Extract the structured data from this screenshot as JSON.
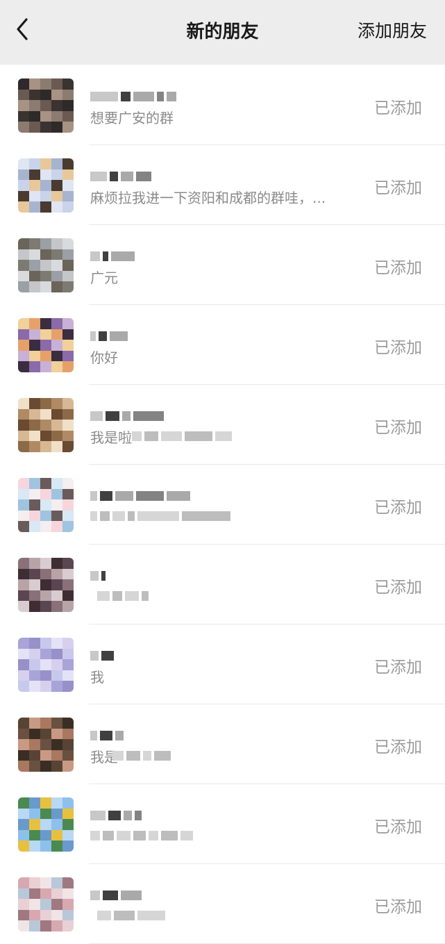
{
  "nav": {
    "back_icon": "chevron-left-icon",
    "title": "新的朋友",
    "action_label": "添加朋友"
  },
  "requests": [
    {
      "message": "想要广安的群",
      "status": "已添加",
      "avatar_colors": [
        "#2d2a29",
        "#6b5a52",
        "#a89284",
        "#3a3330",
        "#8c7b70"
      ]
    },
    {
      "message": "麻烦拉我进一下资阳和成都的群哇，...",
      "status": "已添加",
      "avatar_colors": [
        "#c9d4ea",
        "#4a3a30",
        "#e8c89a",
        "#dfe5f2",
        "#a7b4cf"
      ]
    },
    {
      "message": "广元",
      "status": "已添加",
      "avatar_colors": [
        "#9b9fa6",
        "#6a645a",
        "#c4c6ca",
        "#7d7a72",
        "#d9dadc"
      ]
    },
    {
      "message": "你好",
      "status": "已添加",
      "avatar_colors": [
        "#8a6aa8",
        "#e6a16a",
        "#c9b0d6",
        "#3a2d3f",
        "#f1d09a"
      ]
    },
    {
      "message": "我是啦",
      "status": "已添加",
      "avatar_colors": [
        "#d6b894",
        "#8c6a48",
        "#f0e0c8",
        "#b08a64",
        "#6a4a30"
      ]
    },
    {
      "message": "",
      "status": "已添加",
      "avatar_colors": [
        "#f6d6dc",
        "#d8e8f4",
        "#9ec4e0",
        "#f4eef0",
        "#6a5a5a"
      ]
    },
    {
      "message": "",
      "status": "已添加",
      "avatar_colors": [
        "#b8a4a8",
        "#5a4650",
        "#d8ccd0",
        "#8a7078",
        "#3e2e34"
      ]
    },
    {
      "message": "我",
      "status": "已添加",
      "avatar_colors": [
        "#c8c8ec",
        "#a8a4d8",
        "#e4e2f6",
        "#9890c8",
        "#d6d0ee"
      ]
    },
    {
      "message": "我是",
      "status": "已添加",
      "avatar_colors": [
        "#6a5040",
        "#c89a84",
        "#3a2e24",
        "#a87860",
        "#584434"
      ]
    },
    {
      "message": "",
      "status": "已添加",
      "avatar_colors": [
        "#8ec0ec",
        "#e8c040",
        "#4a8a50",
        "#b8d8f4",
        "#6a9acc"
      ]
    },
    {
      "message": "",
      "status": "已添加",
      "avatar_colors": [
        "#d8a8b0",
        "#b8c8d8",
        "#e8d0d4",
        "#a07880",
        "#f0e4e6"
      ]
    }
  ]
}
